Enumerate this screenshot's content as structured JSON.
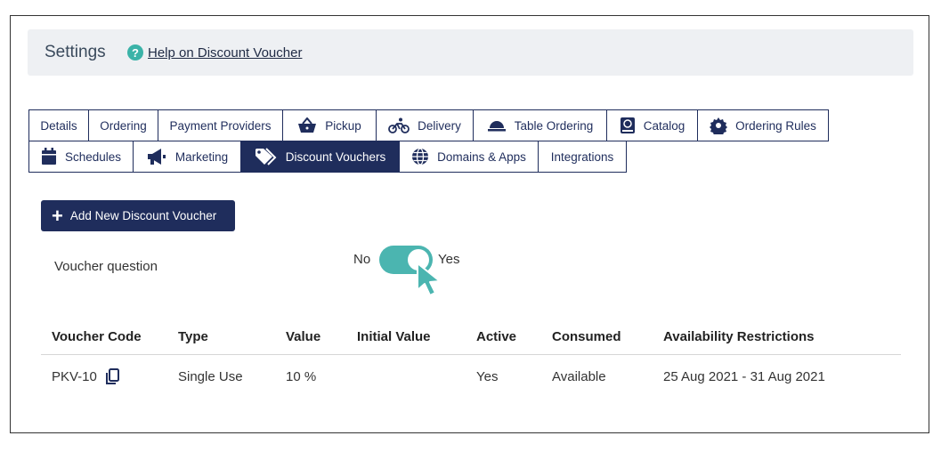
{
  "header": {
    "title": "Settings",
    "help_link": "Help on Discount Voucher",
    "help_glyph": "?"
  },
  "tabs": {
    "row1": [
      {
        "label": "Details",
        "icon": null
      },
      {
        "label": "Ordering",
        "icon": null
      },
      {
        "label": "Payment Providers",
        "icon": null
      },
      {
        "label": "Pickup",
        "icon": "basket-icon"
      },
      {
        "label": "Delivery",
        "icon": "bicycle-icon"
      },
      {
        "label": "Table Ordering",
        "icon": "cloche-icon"
      },
      {
        "label": "Catalog",
        "icon": "book-icon"
      },
      {
        "label": "Ordering Rules",
        "icon": "gear-icon"
      }
    ],
    "row2": [
      {
        "label": "Schedules",
        "icon": "calendar-icon"
      },
      {
        "label": "Marketing",
        "icon": "megaphone-icon"
      },
      {
        "label": "Discount Vouchers",
        "icon": "tags-icon",
        "active": true
      },
      {
        "label": "Domains & Apps",
        "icon": "globe-icon"
      },
      {
        "label": "Integrations",
        "icon": null
      }
    ]
  },
  "add_button": {
    "label": "Add New Discount Voucher",
    "glyph": "+"
  },
  "voucher_question": {
    "label": "Voucher question",
    "off_label": "No",
    "on_label": "Yes",
    "value": true
  },
  "table": {
    "headers": [
      "Voucher Code",
      "Type",
      "Value",
      "Initial Value",
      "Active",
      "Consumed",
      "Availability Restrictions"
    ],
    "rows": [
      [
        "PKV-10",
        "Single Use",
        "10 %",
        "",
        "Yes",
        "Available",
        "25 Aug 2021 - 31 Aug 2021"
      ]
    ]
  },
  "colors": {
    "primary": "#1f2d5c",
    "accent": "#4bb5b0",
    "header_bg": "#eef0f3"
  }
}
